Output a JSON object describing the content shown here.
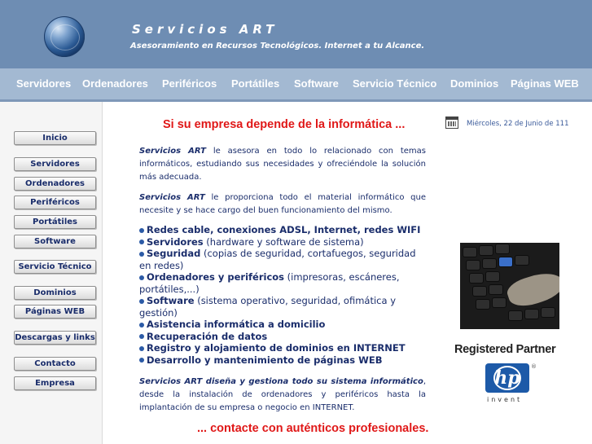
{
  "header": {
    "brand": "Servicios ART",
    "tagline": "Asesoramiento en Recursos Tecnológicos. Internet a tu Alcance."
  },
  "topnav": {
    "items": [
      "Servidores",
      "Ordenadores",
      "Periféricos",
      "Portátiles",
      "Software",
      "Servicio Técnico",
      "Dominios",
      "Páginas WEB"
    ]
  },
  "sidebar": {
    "items": [
      "Inicio",
      "Servidores",
      "Ordenadores",
      "Periféricos",
      "Portátiles",
      "Software",
      "Servicio Técnico",
      "Dominios",
      "Páginas WEB",
      "Descargas y links",
      "Contacto",
      "Empresa"
    ]
  },
  "main": {
    "headline": "Si su empresa depende de la informática ...",
    "intro_brand": "Servicios ART",
    "intro_text": "le asesora en todo lo relacionado con temas informáticos, estudiando sus necesidades y ofreciéndole la solución más adecuada.",
    "second_brand": "Servicios ART",
    "second_text": "le proporciona todo el material informático que necesite y se hace cargo del buen funcionamiento del mismo.",
    "bullets": [
      {
        "title": "Redes cable, conexiones ADSL, Internet, redes WIFI",
        "desc": ""
      },
      {
        "title": "Servidores",
        "desc": " (hardware y software de sistema)"
      },
      {
        "title": "Seguridad",
        "desc": " (copias de seguridad, cortafuegos, seguridad en redes)"
      },
      {
        "title": "Ordenadores y periféricos",
        "desc": " (impresoras, escáneres, portátiles,...)"
      },
      {
        "title": "Software",
        "desc": " (sistema operativo, seguridad, ofimática y gestión)"
      },
      {
        "title": "Asistencia informática a domicilio",
        "desc": ""
      },
      {
        "title": "Recuperación de datos",
        "desc": ""
      },
      {
        "title": "Registro y alojamiento de dominios en INTERNET",
        "desc": ""
      },
      {
        "title": "Desarrollo y mantenimiento de páginas WEB",
        "desc": ""
      }
    ],
    "third_brand": "Servicios ART diseña y gestiona todo su sistema informático",
    "third_text": ", desde la instalación de ordenadores y periféricos hasta la implantación de su empresa o negocio en INTERNET.",
    "closing": "... contacte con auténticos profesionales."
  },
  "right": {
    "date": "Miércoles, 22 de Junio de 111",
    "partner": "Registered Partner",
    "hp_logo": "hp",
    "hp_reg": "®",
    "hp_invent": "invent"
  },
  "colors": {
    "header_bg": "#6e8db3",
    "nav_bg": "#a3b9d2",
    "accent_red": "#e01818",
    "text_navy": "#1a2d6b"
  }
}
